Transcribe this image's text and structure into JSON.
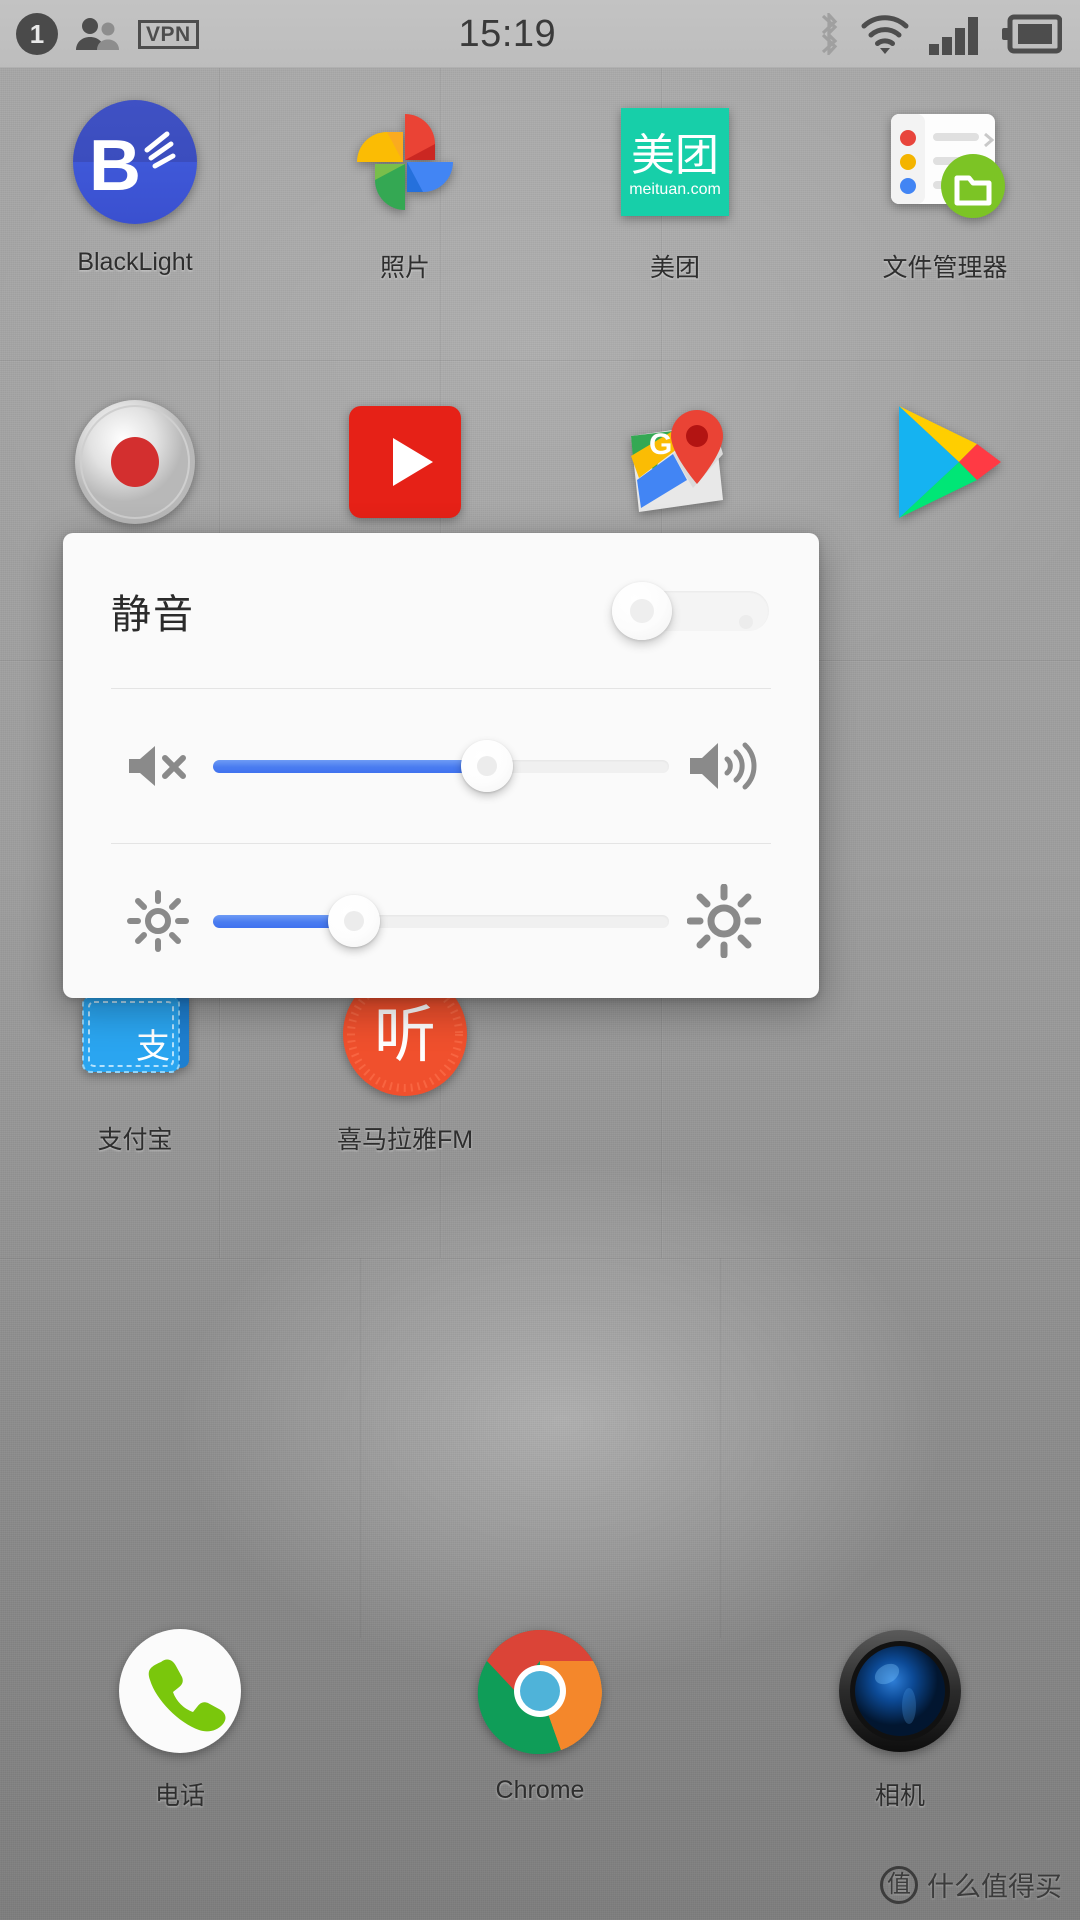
{
  "status_bar": {
    "sim_badge": "1",
    "contacts_icon": "contacts-icon",
    "vpn_label": "VPN",
    "clock": "15:19",
    "bluetooth_icon": "bluetooth-icon",
    "wifi_icon": "wifi-icon",
    "signal_icon": "cellular-signal-icon",
    "battery_icon": "battery-icon"
  },
  "home_screen": {
    "rows": [
      [
        {
          "label": "BlackLight",
          "icon": "blacklight-app-icon"
        },
        {
          "label": "照片",
          "icon": "google-photos-icon"
        },
        {
          "label": "美团",
          "icon": "meituan-icon"
        },
        {
          "label": "文件管理器",
          "icon": "file-manager-icon"
        }
      ],
      [
        {
          "label": "",
          "icon": "sound-recorder-icon"
        },
        {
          "label": "",
          "icon": "youtube-icon"
        },
        {
          "label": "",
          "icon": "google-maps-icon"
        },
        {
          "label": "",
          "icon": "play-store-icon"
        }
      ],
      [
        {
          "label": "支付宝",
          "icon": "alipay-icon"
        },
        {
          "label": "喜马拉雅FM",
          "icon": "ximalaya-fm-icon"
        },
        {
          "label": "",
          "icon": ""
        },
        {
          "label": "",
          "icon": ""
        }
      ]
    ],
    "dock": [
      {
        "label": "电话",
        "icon": "phone-dialer-icon"
      },
      {
        "label": "Chrome",
        "icon": "chrome-icon"
      },
      {
        "label": "相机",
        "icon": "camera-icon"
      }
    ]
  },
  "meituan_icon": {
    "main_text": "美团",
    "sub_text": "meituan.com"
  },
  "blacklight_icon": {
    "letter": "B"
  },
  "ximalaya_icon": {
    "glyph": "听"
  },
  "alipay_icon": {
    "glyph": "支"
  },
  "control_dialog": {
    "mute": {
      "label": "静音",
      "toggle_name": "mute-toggle",
      "state": "off"
    },
    "volume": {
      "left_icon": "volume-mute-icon",
      "right_icon": "volume-high-icon",
      "value": 60,
      "min": 0,
      "max": 100
    },
    "brightness": {
      "left_icon": "brightness-low-icon",
      "right_icon": "brightness-high-icon",
      "value": 31,
      "min": 0,
      "max": 100
    }
  },
  "watermark": {
    "badge": "值",
    "text": "什么值得买"
  },
  "colors": {
    "slider_accent": "#4a7cf0",
    "dialog_bg": "#fafafa",
    "statusbar_bg": "#c0c0c0",
    "label_text": "#2e2e2e"
  }
}
